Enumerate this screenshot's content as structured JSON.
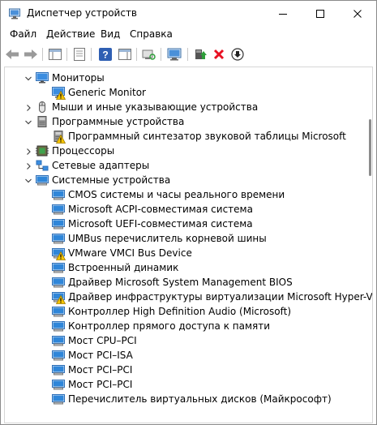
{
  "window": {
    "title": "Диспетчер устройств"
  },
  "menu": [
    {
      "label": "Файл"
    },
    {
      "label": "Действие"
    },
    {
      "label": "Вид"
    },
    {
      "label": "Справка"
    }
  ],
  "tree": [
    {
      "level": 0,
      "expand": "open",
      "icon": "monitor-icon",
      "warn": false,
      "label": "Мониторы"
    },
    {
      "level": 1,
      "expand": "none",
      "icon": "monitor-icon",
      "warn": true,
      "label": "Generic Monitor"
    },
    {
      "level": 0,
      "expand": "closed",
      "icon": "mouse-icon",
      "warn": false,
      "label": "Мыши и иные указывающие устройства"
    },
    {
      "level": 0,
      "expand": "open",
      "icon": "software-icon",
      "warn": false,
      "label": "Программные устройства"
    },
    {
      "level": 1,
      "expand": "none",
      "icon": "software-icon",
      "warn": true,
      "label": "Программный синтезатор звуковой таблицы Microsoft"
    },
    {
      "level": 0,
      "expand": "closed",
      "icon": "cpu-icon",
      "warn": false,
      "label": "Процессоры"
    },
    {
      "level": 0,
      "expand": "closed",
      "icon": "network-icon",
      "warn": false,
      "label": "Сетевые адаптеры"
    },
    {
      "level": 0,
      "expand": "open",
      "icon": "system-icon",
      "warn": false,
      "label": "Системные устройства"
    },
    {
      "level": 1,
      "expand": "none",
      "icon": "system-icon",
      "warn": false,
      "label": "CMOS системы и часы реального времени"
    },
    {
      "level": 1,
      "expand": "none",
      "icon": "system-icon",
      "warn": false,
      "label": "Microsoft ACPI-совместимая система"
    },
    {
      "level": 1,
      "expand": "none",
      "icon": "system-icon",
      "warn": false,
      "label": "Microsoft UEFI-совместимая система"
    },
    {
      "level": 1,
      "expand": "none",
      "icon": "system-icon",
      "warn": false,
      "label": "UMBus перечислитель корневой шины"
    },
    {
      "level": 1,
      "expand": "none",
      "icon": "system-icon",
      "warn": true,
      "label": "VMware VMCI Bus Device"
    },
    {
      "level": 1,
      "expand": "none",
      "icon": "system-icon",
      "warn": false,
      "label": "Встроенный динамик"
    },
    {
      "level": 1,
      "expand": "none",
      "icon": "system-icon",
      "warn": false,
      "label": "Драйвер Microsoft System Management BIOS"
    },
    {
      "level": 1,
      "expand": "none",
      "icon": "system-icon",
      "warn": true,
      "label": "Драйвер инфраструктуры виртуализации Microsoft Hyper-V"
    },
    {
      "level": 1,
      "expand": "none",
      "icon": "system-icon",
      "warn": false,
      "label": "Контроллер High Definition Audio (Microsoft)"
    },
    {
      "level": 1,
      "expand": "none",
      "icon": "system-icon",
      "warn": false,
      "label": "Контроллер прямого доступа к памяти"
    },
    {
      "level": 1,
      "expand": "none",
      "icon": "system-icon",
      "warn": false,
      "label": "Мост CPU–PCI"
    },
    {
      "level": 1,
      "expand": "none",
      "icon": "system-icon",
      "warn": false,
      "label": "Мост PCI–ISA"
    },
    {
      "level": 1,
      "expand": "none",
      "icon": "system-icon",
      "warn": false,
      "label": "Мост PCI–PCI"
    },
    {
      "level": 1,
      "expand": "none",
      "icon": "system-icon",
      "warn": false,
      "label": "Мост PCI–PCI"
    },
    {
      "level": 1,
      "expand": "none",
      "icon": "system-icon",
      "warn": false,
      "label": "Перечислитель виртуальных дисков (Майкрософт)"
    }
  ],
  "colors": {
    "accent_blue": "#1e78d0",
    "warning_yellow": "#f5c400",
    "delete_red": "#e81123",
    "update_green": "#2e9e3a"
  }
}
